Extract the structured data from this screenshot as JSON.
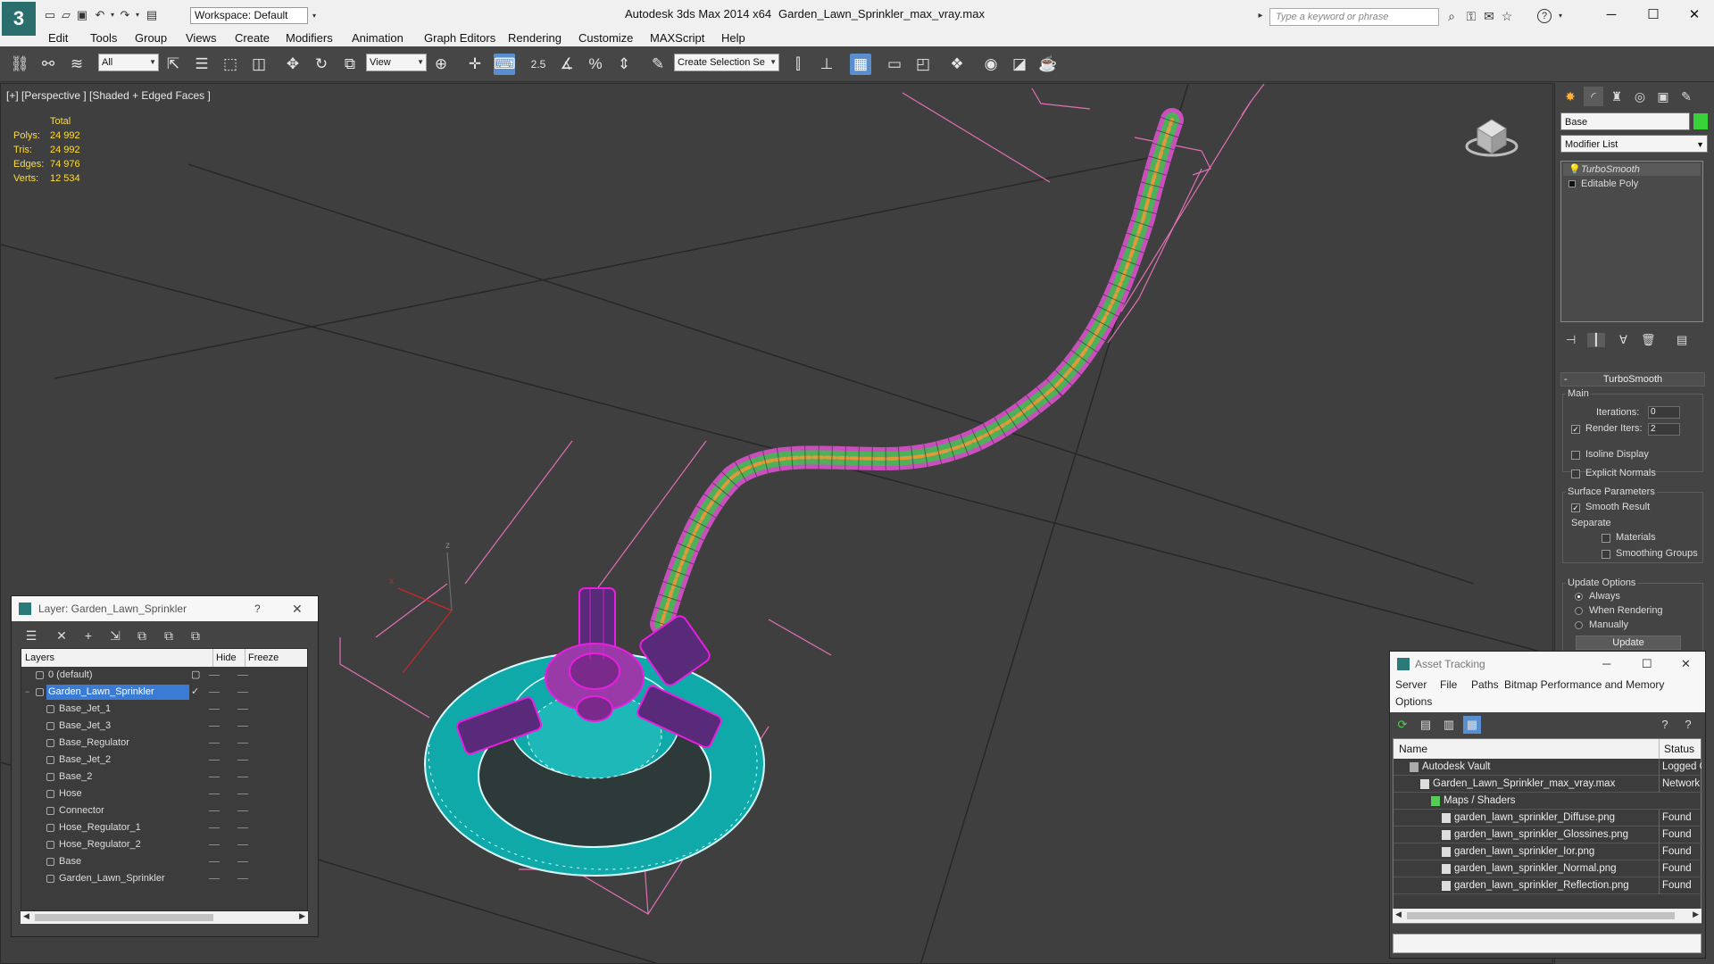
{
  "titlebar": {
    "workspace": "Workspace: Default",
    "app_title": "Autodesk 3ds Max  2014 x64",
    "file_name": "Garden_Lawn_Sprinkler_max_vray.max",
    "search_placeholder": "Type a keyword or phrase"
  },
  "menus": [
    "Edit",
    "Tools",
    "Group",
    "Views",
    "Create",
    "Modifiers",
    "Animation",
    "Graph Editors",
    "Rendering",
    "Customize",
    "MAXScript",
    "Help"
  ],
  "toolbar": {
    "selection_filter": "All",
    "ref_coord": "View",
    "snap_label": "2.5",
    "named_selection": "Create Selection Se"
  },
  "viewport": {
    "label": "[+] [Perspective ] [Shaded + Edged Faces ]",
    "stats": {
      "header": "Total",
      "rows": [
        {
          "k": "Polys:",
          "v": "24 992"
        },
        {
          "k": "Tris:",
          "v": "24 992"
        },
        {
          "k": "Edges:",
          "v": "74 976"
        },
        {
          "k": "Verts:",
          "v": "12 534"
        }
      ]
    },
    "colors": {
      "sprinkler_base": "#0fa9a9",
      "wire_selected": "#e91ee0",
      "hose_green": "#4fb05a",
      "hose_orange": "#e09a3a",
      "grid": "#262626"
    }
  },
  "command_panel": {
    "object_name": "Base",
    "object_color": "#39d239",
    "modifier_list": "Modifier List",
    "stack": [
      "TurboSmooth",
      "Editable Poly"
    ],
    "turbosmooth": {
      "title": "TurboSmooth",
      "main_label": "Main",
      "iterations_label": "Iterations:",
      "iterations": "0",
      "render_iters_label": "Render Iters:",
      "render_iters": "2",
      "isoline": "Isoline Display",
      "explicit_normals": "Explicit Normals",
      "surface_params": "Surface Parameters",
      "smooth_result": "Smooth Result",
      "separate": "Separate",
      "materials": "Materials",
      "smoothing_groups": "Smoothing Groups",
      "update_options": "Update Options",
      "always": "Always",
      "when_rendering": "When Rendering",
      "manually": "Manually",
      "update_button": "Update"
    }
  },
  "layer_dialog": {
    "title": "Layer: Garden_Lawn_Sprinkler",
    "help": "?",
    "columns": [
      "Layers",
      "Hide",
      "Freeze"
    ],
    "rows": [
      {
        "name": "0 (default)",
        "level": 0,
        "selected": false
      },
      {
        "name": "Garden_Lawn_Sprinkler",
        "level": 0,
        "selected": true,
        "current_mark": "✓"
      },
      {
        "name": "Base_Jet_1",
        "level": 1
      },
      {
        "name": "Base_Jet_3",
        "level": 1
      },
      {
        "name": "Base_Regulator",
        "level": 1
      },
      {
        "name": "Base_Jet_2",
        "level": 1
      },
      {
        "name": "Base_2",
        "level": 1
      },
      {
        "name": "Hose",
        "level": 1
      },
      {
        "name": "Connector",
        "level": 1
      },
      {
        "name": "Hose_Regulator_1",
        "level": 1
      },
      {
        "name": "Hose_Regulator_2",
        "level": 1
      },
      {
        "name": "Base",
        "level": 1
      },
      {
        "name": "Garden_Lawn_Sprinkler",
        "level": 1
      }
    ]
  },
  "asset_tracking": {
    "title": "Asset Tracking",
    "menu": [
      "Server",
      "File",
      "Paths",
      "Bitmap Performance and Memory",
      "Options"
    ],
    "columns": [
      "Name",
      "Status"
    ],
    "rows": [
      {
        "name": "Autodesk Vault",
        "status": "Logged O",
        "indent": 1
      },
      {
        "name": "Garden_Lawn_Sprinkler_max_vray.max",
        "status": "Network",
        "indent": 2
      },
      {
        "name": "Maps / Shaders",
        "status": "",
        "indent": 3
      },
      {
        "name": "garden_lawn_sprinkler_Diffuse.png",
        "status": "Found",
        "indent": 4
      },
      {
        "name": "garden_lawn_sprinkler_Glossines.png",
        "status": "Found",
        "indent": 4
      },
      {
        "name": "garden_lawn_sprinkler_Ior.png",
        "status": "Found",
        "indent": 4
      },
      {
        "name": "garden_lawn_sprinkler_Normal.png",
        "status": "Found",
        "indent": 4
      },
      {
        "name": "garden_lawn_sprinkler_Reflection.png",
        "status": "Found",
        "indent": 4
      }
    ]
  }
}
